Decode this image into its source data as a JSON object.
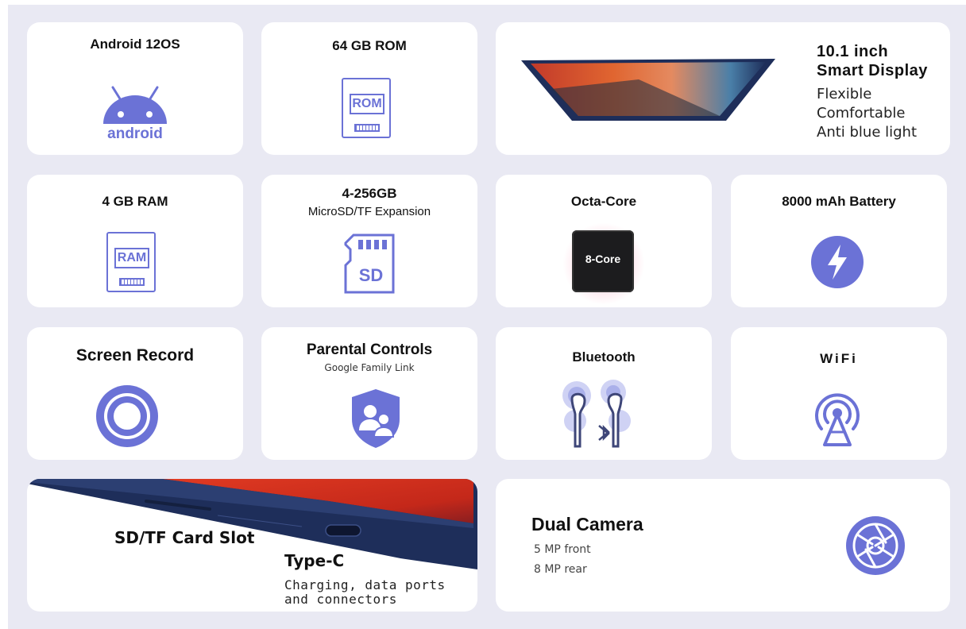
{
  "colors": {
    "accent": "#6b72d6",
    "accent_light": "#cfd2f4",
    "navy": "#1e2e5a",
    "background": "#e9e9f3"
  },
  "android": {
    "title": "Android 12OS",
    "logo_text": "android",
    "icon": "android-icon"
  },
  "rom": {
    "title": "64 GB ROM",
    "chip_label": "ROM",
    "icon": "rom-chip-icon"
  },
  "display": {
    "title_line1": "10.1 inch",
    "title_line2": "Smart Display",
    "features": [
      "Flexible",
      "Comfortable",
      "Anti blue light"
    ]
  },
  "ram": {
    "title": "4 GB RAM",
    "chip_label": "RAM",
    "icon": "ram-chip-icon"
  },
  "sd": {
    "title": "4-256GB",
    "subtitle": "MicroSD/TF Expansion",
    "card_label": "SD",
    "icon": "sd-card-icon"
  },
  "cpu": {
    "title": "Octa-Core",
    "chip_label": "8-Core",
    "icon": "cpu-chip-icon"
  },
  "battery": {
    "title": "8000 mAh Battery",
    "icon": "lightning-icon"
  },
  "record": {
    "title": "Screen Record",
    "icon": "record-icon"
  },
  "parental": {
    "title": "Parental Controls",
    "subtitle": "Google Family Link",
    "icon": "family-shield-icon"
  },
  "bluetooth": {
    "title": "Bluetooth",
    "icon": "earbuds-bluetooth-icon"
  },
  "wifi": {
    "title": "WiFi",
    "icon": "wifi-antenna-icon"
  },
  "ports": {
    "slot_label": "SD/TF Card Slot",
    "port_title": "Type-C",
    "port_desc_line1": "Charging, data ports",
    "port_desc_line2": "and connectors"
  },
  "camera": {
    "title": "Dual Camera",
    "front": "5 MP front",
    "rear": "8 MP rear",
    "icon": "camera-aperture-icon"
  }
}
